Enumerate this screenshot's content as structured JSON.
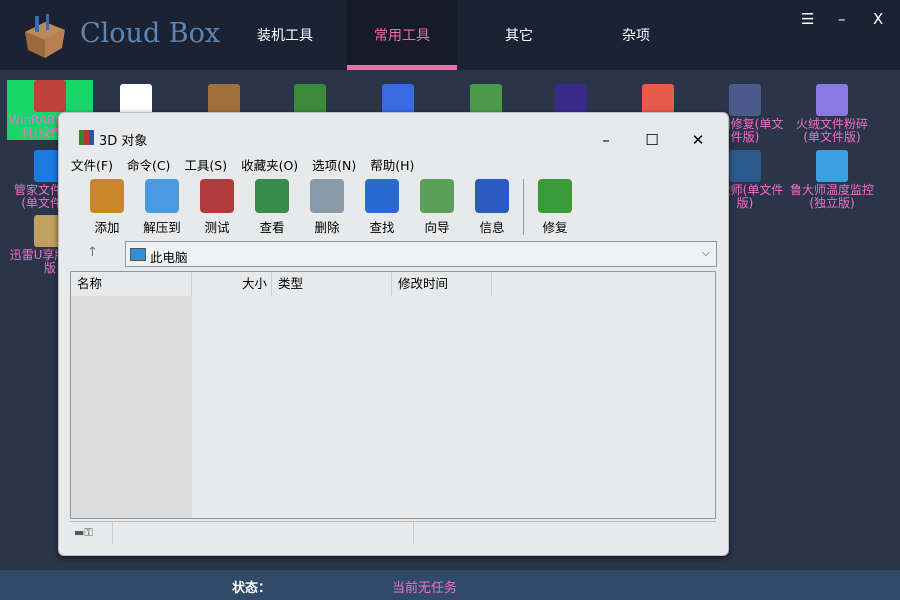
{
  "app": {
    "title": "Cloud Box",
    "tabs": [
      {
        "label": "装机工具"
      },
      {
        "label": "常用工具"
      },
      {
        "label": "其它"
      },
      {
        "label": "杂项"
      }
    ],
    "active_tab": "常用工具",
    "controls": {
      "menu": "☰",
      "minimize": "–",
      "close": "X"
    }
  },
  "desktop": {
    "icons": [
      {
        "label": "WinRAR解压工具(绿色版)",
        "color": "#c04040"
      },
      {
        "label": "",
        "color": "#ffffff"
      },
      {
        "label": "",
        "color": "#a0703a"
      },
      {
        "label": "",
        "color": "#3a8a3a"
      },
      {
        "label": "",
        "color": "#3a6ae0"
      },
      {
        "label": "",
        "color": "#4a9a4a"
      },
      {
        "label": "",
        "color": "#3a2a8a"
      },
      {
        "label": "",
        "color": "#e85a4a"
      },
      {
        "label": "断网修复(单文件版)",
        "color": "#4a5a8a"
      },
      {
        "label": "火绒文件粉碎(单文件版)",
        "color": "#8a7ae0"
      },
      {
        "label": "管家文件粉碎(单文件版)",
        "color": "#1a7ae0"
      },
      {
        "label": "鲁大师(单文件版)",
        "color": "#2a5a8a"
      },
      {
        "label": "鲁大师温度监控(独立版)",
        "color": "#3aa0e0"
      },
      {
        "label": "迅雷U享版破解版",
        "color": "#c0a060"
      }
    ]
  },
  "winrar": {
    "title": "3D 对象",
    "controls": {
      "minimize": "–",
      "maximize": "☐",
      "close": "✕"
    },
    "menu": [
      "文件(F)",
      "命令(C)",
      "工具(S)",
      "收藏夹(O)",
      "选项(N)",
      "帮助(H)"
    ],
    "toolbar": [
      {
        "label": "添加",
        "color": "#c8882a"
      },
      {
        "label": "解压到",
        "color": "#4a9ae0"
      },
      {
        "label": "测试",
        "color": "#b03a3a"
      },
      {
        "label": "查看",
        "color": "#3a8a4a"
      },
      {
        "label": "删除",
        "color": "#8a9aaa"
      },
      {
        "label": "查找",
        "color": "#2a6ad0"
      },
      {
        "label": "向导",
        "color": "#5aa05a"
      },
      {
        "label": "信息",
        "color": "#2a5ac0"
      },
      {
        "label": "修复",
        "color": "#3a9a3a"
      }
    ],
    "address": "此电脑",
    "columns": [
      "名称",
      "大小",
      "类型",
      "修改时间"
    ]
  },
  "status": {
    "label": "状态：",
    "value": "当前无任务",
    "value_color": "#f06ec8"
  }
}
